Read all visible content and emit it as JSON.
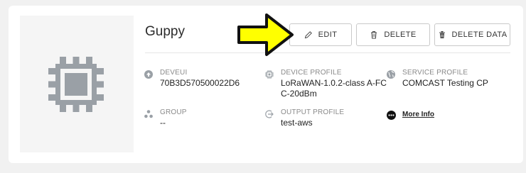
{
  "device": {
    "name": "Guppy",
    "chip_icon": "chip-icon"
  },
  "actions": {
    "edit_label": "EDIT",
    "delete_label": "DELETE",
    "delete_data_label": "DELETE DATA"
  },
  "fields": {
    "deveui": {
      "label": "DEVEUI",
      "value": "70B3D570500022D6",
      "icon": "arrow-up-circle-icon"
    },
    "group": {
      "label": "GROUP",
      "value": "--",
      "icon": "group-nodes-icon"
    },
    "device_profile": {
      "label": "DEVICE PROFILE",
      "value": "LoRaWAN-1.0.2-class A-FC C-20dBm",
      "icon": "chip-small-icon"
    },
    "output_profile": {
      "label": "OUTPUT PROFILE",
      "value": "test-aws",
      "icon": "output-arrow-icon"
    },
    "service_profile": {
      "label": "SERVICE PROFILE",
      "value": "COMCAST Testing CP",
      "icon": "globe-icon"
    },
    "more_info": {
      "label": "More Info",
      "icon": "ellipsis-circle-icon"
    }
  },
  "colors": {
    "annotation_arrow": "#ffff00",
    "icon_gray": "#9aa0a6",
    "card_bg": "#ffffff",
    "page_bg": "#f1f1f1"
  }
}
